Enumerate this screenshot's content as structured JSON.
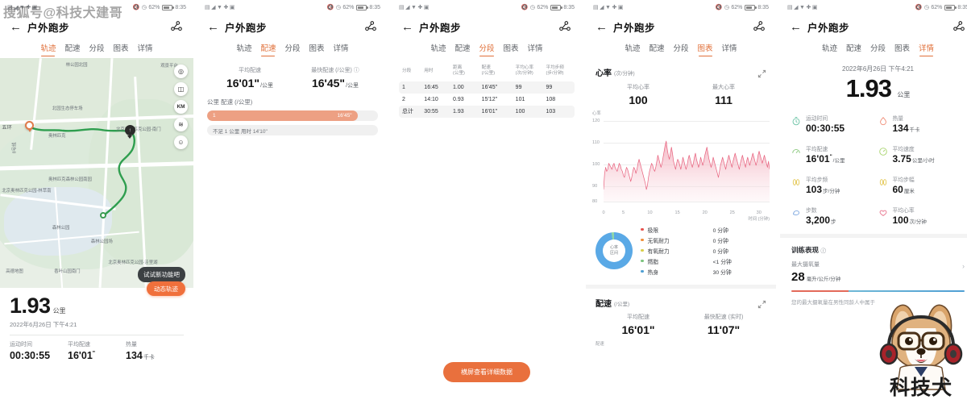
{
  "watermarks": {
    "top_left": "搜狐号@科技犬建哥",
    "bottom_right_text": "科技犬"
  },
  "status_bar": {
    "battery": "62%",
    "time": "8:35"
  },
  "app": {
    "title": "户外跑步",
    "back_icon": "back-arrow-icon",
    "share_icon": "share-icon",
    "tabs": [
      "轨迹",
      "配速",
      "分段",
      "图表",
      "详情"
    ]
  },
  "panel1": {
    "active_tab": "轨迹",
    "map": {
      "labels": [
        "林公园北园",
        "观景平台",
        "北园生态停车场",
        "五环",
        "8号线",
        "奥林匹克",
        "森林公园",
        "奥林匹克森林公园南园",
        "北京奥林匹克公园-林萃南",
        "北京奥林匹克公园-洼里湖",
        "北京奥林匹克公园-南门",
        "森林公园场",
        "高德地图",
        "香叶山园南门"
      ],
      "controls": [
        "locate-icon",
        "map-style-icon",
        "KM",
        "layers-icon",
        "person-icon"
      ],
      "start_marker": "start-pin",
      "end_marker": "end-pin"
    },
    "distance": {
      "value": "1.93",
      "unit": "公里"
    },
    "datetime": "2022年6月26日 下午4:21",
    "tooltip": "试试新功能吧",
    "cta": "动态轨迹",
    "stats": [
      {
        "label": "运动时间",
        "value": "00:30:55",
        "unit": ""
      },
      {
        "label": "平均配速",
        "value": "16'01",
        "sup": "\"",
        "unit": ""
      },
      {
        "label": "热量",
        "value": "134",
        "unit": "千卡"
      }
    ]
  },
  "panel2": {
    "active_tab": "配速",
    "summary": [
      {
        "label": "平均配速",
        "value": "16'01\"",
        "unit": "/公里"
      },
      {
        "label": "最快配速 (/公里)",
        "value": "16'45\"",
        "unit": "/公里",
        "info_icon": "info-icon"
      }
    ],
    "section_header": "公里  配速 (/公里)",
    "bars": [
      {
        "km": "1",
        "pace": "16'45\"",
        "percent": 88
      }
    ],
    "bar_note": "不足 1 公里 用时 14'10\""
  },
  "panel3": {
    "active_tab": "分段",
    "table": {
      "headers": [
        "分段",
        "用时",
        "距离\n(公里)",
        "配速\n(/公里)",
        "平均心率\n(次/分钟)",
        "平均步频\n(步/分钟)"
      ],
      "rows": [
        [
          "1",
          "16:45",
          "1.00",
          "16'45\"",
          "99",
          "99"
        ],
        [
          "2",
          "14:10",
          "0.93",
          "15'12\"",
          "101",
          "108"
        ],
        [
          "总计",
          "30:55",
          "1.93",
          "16'01\"",
          "100",
          "103"
        ]
      ]
    },
    "button": "横屏查看详细数据"
  },
  "panel4": {
    "active_tab": "图表",
    "heart_rate": {
      "title": "心率",
      "unit": "(次/分钟)",
      "expand_icon": "expand-icon",
      "avg_label": "平均心率",
      "avg_value": "100",
      "max_label": "最大心率",
      "max_value": "111"
    },
    "zones": {
      "donut_label": "心率\n区间",
      "rows": [
        {
          "name": "极限",
          "value": "0 分钟",
          "color": "#e8534e"
        },
        {
          "name": "无氧耐力",
          "value": "0 分钟",
          "color": "#f0903c"
        },
        {
          "name": "有氧耐力",
          "value": "0 分钟",
          "color": "#d9cf4a"
        },
        {
          "name": "燃脂",
          "value": "<1 分钟",
          "color": "#7cc47f"
        },
        {
          "name": "热身",
          "value": "30 分钟",
          "color": "#4f9fd4"
        }
      ]
    },
    "pace": {
      "title": "配速",
      "unit": "(/公里)",
      "expand_icon": "expand-icon",
      "avg_label": "平均配速",
      "avg_value": "16'01\"",
      "max_label": "最快配速 (实时)",
      "max_value": "11'07\"",
      "axis_label": "配速"
    }
  },
  "panel5": {
    "active_tab": "详情",
    "datetime": "2022年6月26日 下午4:21",
    "distance": {
      "value": "1.93",
      "unit": "公里"
    },
    "metrics": [
      {
        "icon": "stopwatch-icon",
        "label": "运动时间",
        "value": "00:30:55",
        "unit": "",
        "color": "#6fc5a8"
      },
      {
        "icon": "flame-icon",
        "label": "热量",
        "value": "134",
        "unit": "千卡",
        "color": "#f0907a"
      },
      {
        "icon": "pace-icon",
        "label": "平均配速",
        "value": "16'01",
        "sup": "\"",
        "unit": "/公里",
        "color": "#8cc97f"
      },
      {
        "icon": "speed-icon",
        "label": "平均速度",
        "value": "3.75",
        "unit": "公里/小时",
        "color": "#a9d46e"
      },
      {
        "icon": "cadence-icon",
        "label": "平均步频",
        "value": "103",
        "unit": "步/分钟",
        "color": "#e5c95a"
      },
      {
        "icon": "stride-icon",
        "label": "平均步幅",
        "value": "60",
        "unit": "厘米",
        "color": "#e5c95a"
      },
      {
        "icon": "steps-icon",
        "label": "步数",
        "value": "3,200",
        "unit": "步",
        "color": "#7fa8e0"
      },
      {
        "icon": "heart-icon",
        "label": "平均心率",
        "value": "100",
        "unit": "次/分钟",
        "color": "#ea7f96"
      }
    ],
    "training": {
      "title": "训练表现",
      "info_icon": "info-icon",
      "sub_label": "最大摄氧量",
      "value": "28",
      "unit": "毫升/公斤/分钟",
      "note": "您的最大摄氧量在男性同龄人中属于",
      "chevron_icon": "chevron-right-icon"
    }
  },
  "chart_data": [
    {
      "type": "area",
      "title": "心率",
      "ylabel": "心率",
      "xlabel": "时间 (分钟)",
      "ylim": [
        80,
        120
      ],
      "yticks": [
        80,
        90,
        100,
        110,
        120
      ],
      "xlim": [
        0,
        30
      ],
      "xticks": [
        0,
        5,
        10,
        15,
        20,
        25,
        30
      ],
      "grid": true,
      "series_name": "心率",
      "color": "#e8637f",
      "values": [
        86,
        94,
        97,
        95,
        96,
        99,
        98,
        97,
        96,
        98,
        99,
        97,
        96,
        95,
        97,
        99,
        98,
        96,
        95,
        93,
        92,
        95,
        97,
        96,
        94,
        92,
        90,
        92,
        95,
        97,
        96,
        94,
        96,
        99,
        101,
        99,
        97,
        95,
        93,
        91,
        89,
        86,
        88,
        92,
        95,
        97,
        99,
        98,
        96,
        95,
        97,
        100,
        103,
        101,
        99,
        97,
        99,
        102,
        105,
        108,
        110,
        106,
        103,
        101,
        104,
        107,
        104,
        100,
        98,
        96,
        99,
        101,
        100,
        98,
        96,
        99,
        102,
        100,
        98,
        96,
        98,
        101,
        103,
        101,
        99,
        97,
        99,
        102,
        104,
        101,
        99,
        97,
        99,
        102,
        100,
        98,
        100,
        103,
        105,
        107,
        104,
        101,
        99,
        97,
        99,
        102,
        100,
        98,
        96,
        94,
        92,
        95,
        98,
        100,
        102,
        100,
        98,
        96,
        99,
        101,
        103,
        101,
        99,
        97,
        100,
        102,
        104,
        102,
        100,
        98,
        96,
        99,
        101,
        103,
        101,
        99,
        97,
        100,
        102,
        100,
        98,
        100,
        102,
        104,
        102,
        100,
        98,
        100,
        103,
        105,
        103,
        101,
        99,
        101,
        103,
        101,
        99,
        97,
        100,
        96
      ]
    },
    {
      "type": "area",
      "title": "配速",
      "ylabel": "配速",
      "xlabel": "",
      "avg": "16'01\"",
      "max": "11'07\""
    }
  ]
}
